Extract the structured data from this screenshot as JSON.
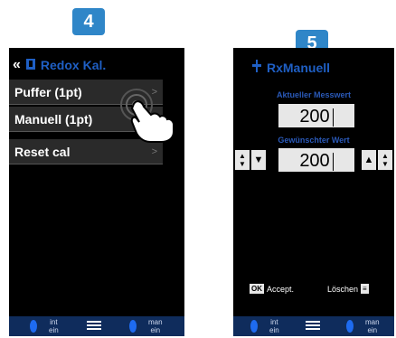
{
  "step_badges": [
    "4",
    "5"
  ],
  "screen4": {
    "back_icon": "double-chevron-left",
    "title_icon": "probe-icon",
    "title": "Redox Kal.",
    "menu": [
      {
        "label": "Puffer (1pt)"
      },
      {
        "label": "Manuell (1pt)"
      },
      {
        "label": "Reset cal"
      }
    ],
    "bottom_bar": {
      "left_text": "int\nein",
      "right_text": "man\nein"
    }
  },
  "screen5": {
    "title_icon": "probe-icon",
    "title": "RxManuell",
    "current_label": "Aktueller Messwert",
    "current_value": "200",
    "desired_label": "Gewünschter Wert",
    "desired_value": "200",
    "accept_badge": "OK",
    "accept_label": "Accept.",
    "delete_label": "Löschen",
    "bottom_bar": {
      "left_text": "int\nein",
      "right_text": "man\nein"
    }
  },
  "colors": {
    "badge": "#2f86c8",
    "screen_bg": "#000000",
    "title_blue": "#1f5fc4",
    "bottom_bar": "#0f2c5c"
  }
}
